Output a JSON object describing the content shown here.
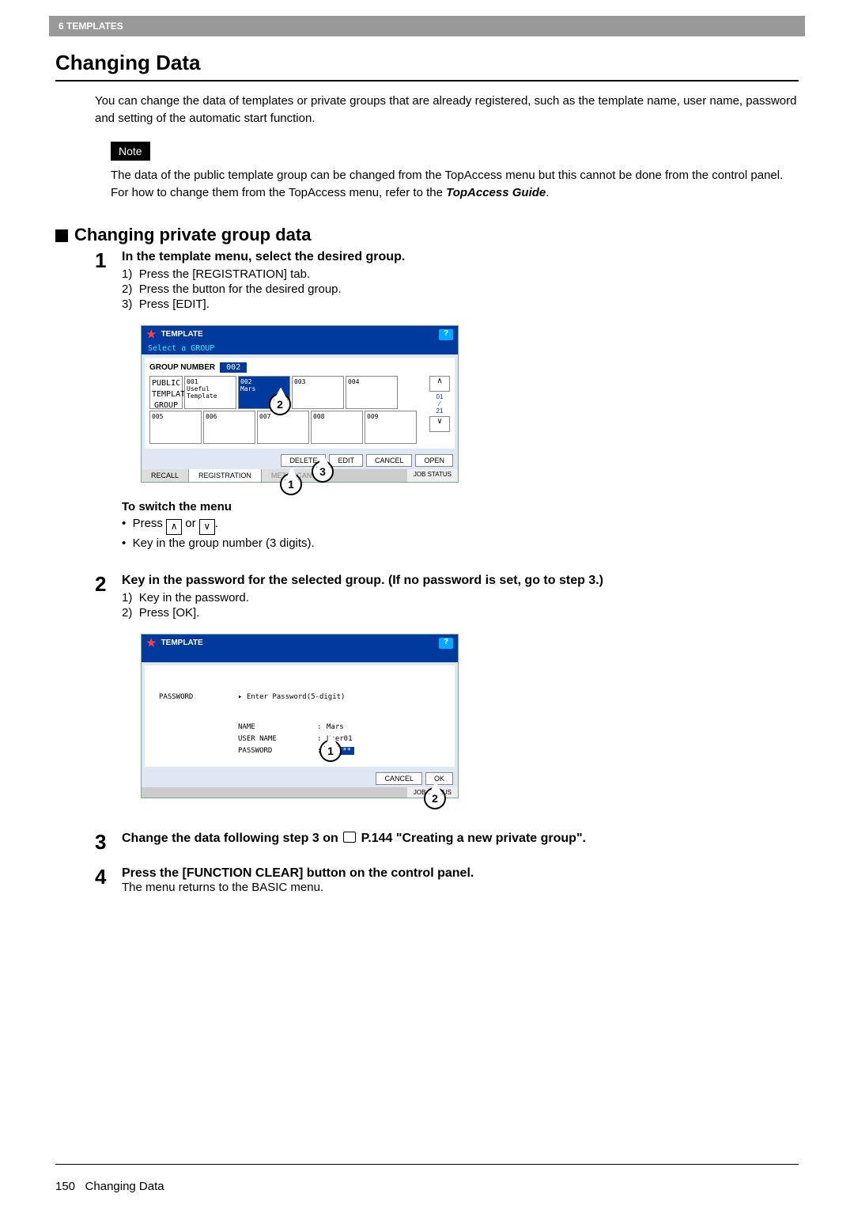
{
  "header": {
    "chapter": "6 TEMPLATES"
  },
  "title": "Changing Data",
  "intro": "You can change the data of templates or private groups that are already registered, such as the template name, user name, password and setting of the automatic start function.",
  "note_label": "Note",
  "note_text_a": "The data of the public template group can be changed from the TopAccess menu but this cannot be done from the control panel. For how to change them from the TopAccess menu, refer to the ",
  "note_text_b": "TopAccess Guide",
  "note_text_c": ".",
  "section_heading": "Changing private group data",
  "steps": {
    "1": {
      "title": "In the template menu, select the desired group.",
      "items": [
        "Press the [REGISTRATION] tab.",
        "Press the button for the desired group.",
        "Press [EDIT]."
      ],
      "switch_heading": "To switch the menu",
      "switch_items_a": "Press ",
      "switch_items_b": " or ",
      "switch_items_c": ".",
      "switch_item2": "Key in the group number (3 digits)."
    },
    "2": {
      "title": "Key in the password for the selected group. (If no password is set, go to step 3.)",
      "items": [
        "Key in the password.",
        "Press [OK]."
      ]
    },
    "3": {
      "title_a": "Change the data following step 3 on ",
      "title_b": " P.144 \"Creating a new private group\"."
    },
    "4": {
      "title": "Press the [FUNCTION CLEAR] button on the control panel.",
      "body": "The menu returns to the BASIC menu."
    }
  },
  "screen1": {
    "title": "TEMPLATE",
    "subtitle": "Select a GROUP",
    "group_number_label": "GROUP NUMBER",
    "group_number": "002",
    "cells_row1": [
      {
        "id": "",
        "txt": "PUBLIC TEMPLATE GROUP"
      },
      {
        "id": "001",
        "txt": "Useful Template"
      },
      {
        "id": "002",
        "txt": "Mars",
        "sel": true
      },
      {
        "id": "003",
        "txt": ""
      },
      {
        "id": "004",
        "txt": ""
      }
    ],
    "cells_row2": [
      {
        "id": "005",
        "txt": ""
      },
      {
        "id": "006",
        "txt": ""
      },
      {
        "id": "007",
        "txt": ""
      },
      {
        "id": "008",
        "txt": ""
      },
      {
        "id": "009",
        "txt": ""
      }
    ],
    "page_indicator_top": "01",
    "page_indicator_bot": "21",
    "buttons": [
      "DELETE",
      "EDIT",
      "CANCEL",
      "OPEN"
    ],
    "tabs": {
      "recall": "RECALL",
      "registration": "REGISTRATION",
      "meta": "META SCAN"
    },
    "jobstatus": "JOB STATUS"
  },
  "screen2": {
    "title": "TEMPLATE",
    "password_label": "PASSWORD",
    "password_hint": "▸ Enter Password(5-digit)",
    "name_label": "NAME",
    "name_val": "Mars",
    "user_label": "USER NAME",
    "user_val": "User01",
    "pw_label": "PASSWORD",
    "pw_val": "*****",
    "cancel": "CANCEL",
    "ok": "OK",
    "jobstatus": "JOB STATUS"
  },
  "footer": {
    "page": "150",
    "title": "Changing Data"
  }
}
